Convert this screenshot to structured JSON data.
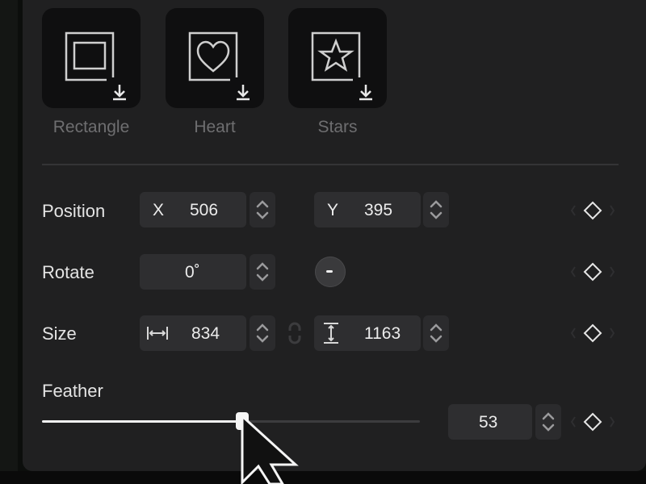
{
  "masks": [
    {
      "label": "Rectangle",
      "icon": "rectangle-mask-icon"
    },
    {
      "label": "Heart",
      "icon": "heart-mask-icon"
    },
    {
      "label": "Stars",
      "icon": "star-mask-icon"
    }
  ],
  "position": {
    "label": "Position",
    "x_axis": "X",
    "x": "506",
    "y_axis": "Y",
    "y": "395"
  },
  "rotate": {
    "label": "Rotate",
    "value": "0˚"
  },
  "size": {
    "label": "Size",
    "width": "834",
    "height": "1163"
  },
  "feather": {
    "label": "Feather",
    "value": "53",
    "fraction": 0.53
  },
  "colors": {
    "panel": "#202021",
    "field": "#2e2e30",
    "accent": "#f2f2f2"
  }
}
